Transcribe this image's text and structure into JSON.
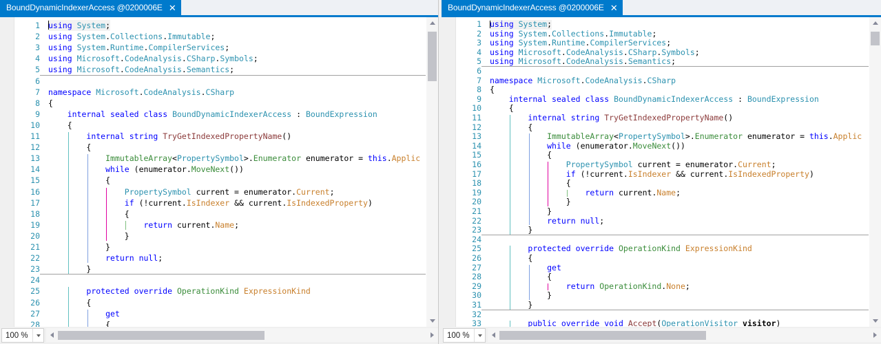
{
  "window": {
    "accent_color": "#007acc",
    "tabstrip_bg": "#eef1f5",
    "editor_bg": "#ffffff"
  },
  "panes": [
    {
      "id": "left",
      "tab": {
        "title": "BoundDynamicIndexerAccess @0200006E",
        "close_label": "✕"
      },
      "zoom": {
        "value": "100 %"
      },
      "visible_line_range": [
        1,
        28
      ]
    },
    {
      "id": "right",
      "tab": {
        "title": "BoundDynamicIndexerAccess @0200006E",
        "close_label": "✕"
      },
      "zoom": {
        "value": "100 %"
      },
      "visible_line_range": [
        1,
        33
      ]
    }
  ],
  "code": {
    "language": "C#",
    "lines": [
      {
        "n": 1,
        "indent": 0,
        "tokens": [
          [
            "kw",
            "using"
          ],
          [
            "pun",
            " "
          ],
          [
            "ty",
            "System"
          ],
          [
            "pun",
            ";"
          ]
        ]
      },
      {
        "n": 2,
        "indent": 0,
        "tokens": [
          [
            "kw",
            "using"
          ],
          [
            "pun",
            " "
          ],
          [
            "ty",
            "System"
          ],
          [
            "pun",
            "."
          ],
          [
            "ty",
            "Collections"
          ],
          [
            "pun",
            "."
          ],
          [
            "ty",
            "Immutable"
          ],
          [
            "pun",
            ";"
          ]
        ]
      },
      {
        "n": 3,
        "indent": 0,
        "tokens": [
          [
            "kw",
            "using"
          ],
          [
            "pun",
            " "
          ],
          [
            "ty",
            "System"
          ],
          [
            "pun",
            "."
          ],
          [
            "ty",
            "Runtime"
          ],
          [
            "pun",
            "."
          ],
          [
            "ty",
            "CompilerServices"
          ],
          [
            "pun",
            ";"
          ]
        ]
      },
      {
        "n": 4,
        "indent": 0,
        "tokens": [
          [
            "kw",
            "using"
          ],
          [
            "pun",
            " "
          ],
          [
            "ty",
            "Microsoft"
          ],
          [
            "pun",
            "."
          ],
          [
            "ty",
            "CodeAnalysis"
          ],
          [
            "pun",
            "."
          ],
          [
            "ty",
            "CSharp"
          ],
          [
            "pun",
            "."
          ],
          [
            "ty",
            "Symbols"
          ],
          [
            "pun",
            ";"
          ]
        ]
      },
      {
        "n": 5,
        "indent": 0,
        "tokens": [
          [
            "kw",
            "using"
          ],
          [
            "pun",
            " "
          ],
          [
            "ty",
            "Microsoft"
          ],
          [
            "pun",
            "."
          ],
          [
            "ty",
            "CodeAnalysis"
          ],
          [
            "pun",
            "."
          ],
          [
            "ty",
            "Semantics"
          ],
          [
            "pun",
            ";"
          ]
        ]
      },
      {
        "n": 6,
        "indent": 0,
        "tokens": []
      },
      {
        "n": 7,
        "indent": 0,
        "tokens": [
          [
            "kw",
            "namespace"
          ],
          [
            "pun",
            " "
          ],
          [
            "ty",
            "Microsoft"
          ],
          [
            "pun",
            "."
          ],
          [
            "ty",
            "CodeAnalysis"
          ],
          [
            "pun",
            "."
          ],
          [
            "ty",
            "CSharp"
          ]
        ]
      },
      {
        "n": 8,
        "indent": 0,
        "tokens": [
          [
            "pun",
            "{"
          ]
        ]
      },
      {
        "n": 9,
        "indent": 1,
        "tokens": [
          [
            "kw",
            "internal"
          ],
          [
            "pun",
            " "
          ],
          [
            "kw",
            "sealed"
          ],
          [
            "pun",
            " "
          ],
          [
            "kw",
            "class"
          ],
          [
            "pun",
            " "
          ],
          [
            "ty",
            "BoundDynamicIndexerAccess"
          ],
          [
            "pun",
            " : "
          ],
          [
            "ty",
            "BoundExpression"
          ]
        ]
      },
      {
        "n": 10,
        "indent": 1,
        "tokens": [
          [
            "pun",
            "{"
          ]
        ]
      },
      {
        "n": 11,
        "indent": 2,
        "tokens": [
          [
            "kw",
            "internal"
          ],
          [
            "pun",
            " "
          ],
          [
            "kw",
            "string"
          ],
          [
            "pun",
            " "
          ],
          [
            "meth",
            "TryGetIndexedPropertyName"
          ],
          [
            "pun",
            "()"
          ]
        ]
      },
      {
        "n": 12,
        "indent": 2,
        "tokens": [
          [
            "pun",
            "{"
          ]
        ]
      },
      {
        "n": 13,
        "indent": 3,
        "tokens": [
          [
            "grn",
            "ImmutableArray"
          ],
          [
            "pun",
            "<"
          ],
          [
            "ty",
            "PropertySymbol"
          ],
          [
            "pun",
            ">."
          ],
          [
            "grn",
            "Enumerator"
          ],
          [
            "pun",
            " "
          ],
          [
            "var",
            "enumerator"
          ],
          [
            "pun",
            " = "
          ],
          [
            "kw",
            "this"
          ],
          [
            "pun",
            "."
          ],
          [
            "prop",
            "Applic"
          ]
        ]
      },
      {
        "n": 14,
        "indent": 3,
        "tokens": [
          [
            "kw",
            "while"
          ],
          [
            "pun",
            " ("
          ],
          [
            "var",
            "enumerator"
          ],
          [
            "pun",
            "."
          ],
          [
            "grn",
            "MoveNext"
          ],
          [
            "pun",
            "())"
          ]
        ]
      },
      {
        "n": 15,
        "indent": 3,
        "tokens": [
          [
            "pun",
            "{"
          ]
        ]
      },
      {
        "n": 16,
        "indent": 4,
        "tokens": [
          [
            "ty",
            "PropertySymbol"
          ],
          [
            "pun",
            " "
          ],
          [
            "var",
            "current"
          ],
          [
            "pun",
            " = "
          ],
          [
            "var",
            "enumerator"
          ],
          [
            "pun",
            "."
          ],
          [
            "prop",
            "Current"
          ],
          [
            "pun",
            ";"
          ]
        ]
      },
      {
        "n": 17,
        "indent": 4,
        "tokens": [
          [
            "kw",
            "if"
          ],
          [
            "pun",
            " (!"
          ],
          [
            "var",
            "current"
          ],
          [
            "pun",
            "."
          ],
          [
            "prop",
            "IsIndexer"
          ],
          [
            "pun",
            " && "
          ],
          [
            "var",
            "current"
          ],
          [
            "pun",
            "."
          ],
          [
            "prop",
            "IsIndexedProperty"
          ],
          [
            "pun",
            ")"
          ]
        ]
      },
      {
        "n": 18,
        "indent": 4,
        "tokens": [
          [
            "pun",
            "{"
          ]
        ]
      },
      {
        "n": 19,
        "indent": 5,
        "tokens": [
          [
            "kw",
            "return"
          ],
          [
            "pun",
            " "
          ],
          [
            "var",
            "current"
          ],
          [
            "pun",
            "."
          ],
          [
            "prop",
            "Name"
          ],
          [
            "pun",
            ";"
          ]
        ]
      },
      {
        "n": 20,
        "indent": 4,
        "tokens": [
          [
            "pun",
            "}"
          ]
        ]
      },
      {
        "n": 21,
        "indent": 3,
        "tokens": [
          [
            "pun",
            "}"
          ]
        ]
      },
      {
        "n": 22,
        "indent": 3,
        "tokens": [
          [
            "kw",
            "return"
          ],
          [
            "pun",
            " "
          ],
          [
            "kw",
            "null"
          ],
          [
            "pun",
            ";"
          ]
        ]
      },
      {
        "n": 23,
        "indent": 2,
        "tokens": [
          [
            "pun",
            "}"
          ]
        ]
      },
      {
        "n": 24,
        "indent": 0,
        "tokens": []
      },
      {
        "n": 25,
        "indent": 2,
        "tokens": [
          [
            "kw",
            "protected"
          ],
          [
            "pun",
            " "
          ],
          [
            "kw",
            "override"
          ],
          [
            "pun",
            " "
          ],
          [
            "grn",
            "OperationKind"
          ],
          [
            "pun",
            " "
          ],
          [
            "prop",
            "ExpressionKind"
          ]
        ]
      },
      {
        "n": 26,
        "indent": 2,
        "tokens": [
          [
            "pun",
            "{"
          ]
        ]
      },
      {
        "n": 27,
        "indent": 3,
        "tokens": [
          [
            "kw",
            "get"
          ]
        ]
      },
      {
        "n": 28,
        "indent": 3,
        "tokens": [
          [
            "pun",
            "{"
          ]
        ]
      },
      {
        "n": 29,
        "indent": 4,
        "tokens": [
          [
            "kw",
            "return"
          ],
          [
            "pun",
            " "
          ],
          [
            "grn",
            "OperationKind"
          ],
          [
            "pun",
            "."
          ],
          [
            "prop",
            "None"
          ],
          [
            "pun",
            ";"
          ]
        ]
      },
      {
        "n": 30,
        "indent": 3,
        "tokens": [
          [
            "pun",
            "}"
          ]
        ]
      },
      {
        "n": 31,
        "indent": 2,
        "tokens": [
          [
            "pun",
            "}"
          ]
        ]
      },
      {
        "n": 32,
        "indent": 0,
        "tokens": []
      },
      {
        "n": 33,
        "indent": 2,
        "tokens": [
          [
            "kw",
            "public"
          ],
          [
            "pun",
            " "
          ],
          [
            "kw",
            "override"
          ],
          [
            "pun",
            " "
          ],
          [
            "kw",
            "void"
          ],
          [
            "pun",
            " "
          ],
          [
            "meth",
            "Accept"
          ],
          [
            "pun",
            "("
          ],
          [
            "ty",
            "OperationVisitor"
          ],
          [
            "pun",
            " "
          ],
          [
            "varb",
            "visitor"
          ],
          [
            "pun",
            ")"
          ]
        ]
      }
    ],
    "separators_after": [
      5,
      23,
      31
    ],
    "colors": {
      "keyword": "#0000ff",
      "type": "#2b91af",
      "member": "#3a8c3a",
      "property": "#c87f2b",
      "method_decl": "#8b3a3a",
      "line_number": "#2b91af",
      "text": "#000000"
    },
    "indent_guides": [
      {
        "level": 1,
        "color": "#60c0c0"
      },
      {
        "level": 2,
        "color": "#7e9fe0"
      },
      {
        "level": 3,
        "color": "#e000a0"
      },
      {
        "level": 4,
        "color": "#7fbf7f"
      }
    ]
  },
  "scrollbars": {
    "vertical_up": "▲",
    "vertical_down": "▼",
    "horizontal_left": "◄",
    "horizontal_right": "►"
  }
}
